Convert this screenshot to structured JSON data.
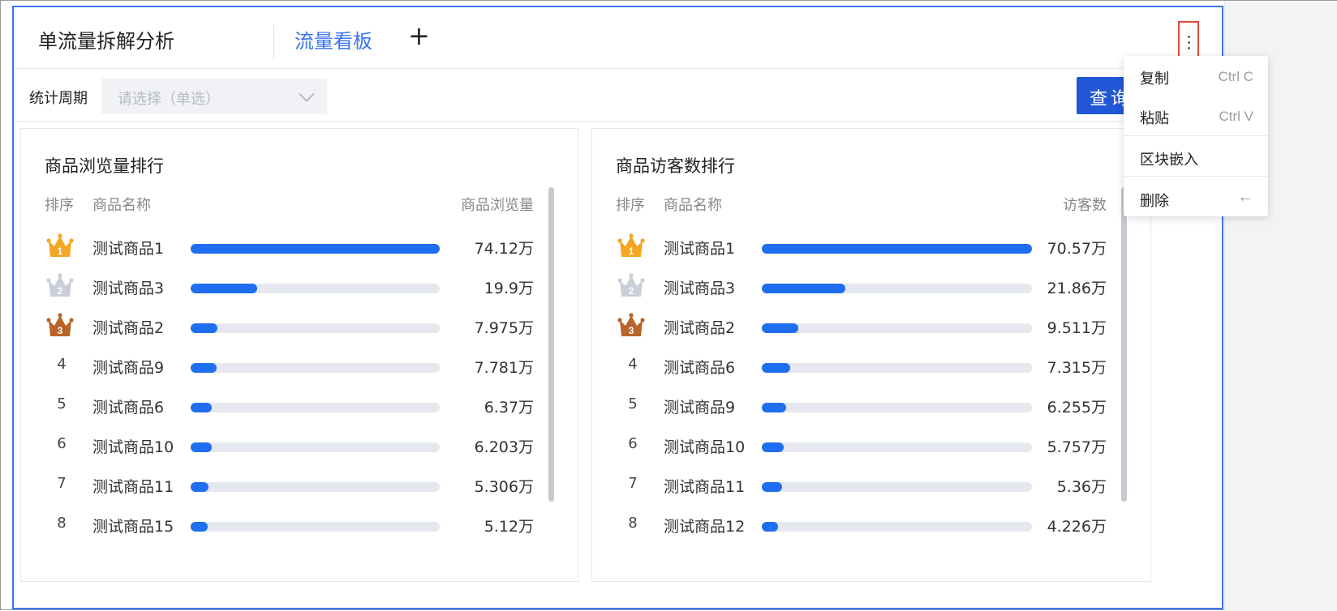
{
  "tabs": [
    {
      "label": "单流量拆解分析",
      "active": false
    },
    {
      "label": "流量看板",
      "active": true
    }
  ],
  "tab_add_label": "+",
  "filter": {
    "label": "统计周期",
    "placeholder": "请选择（单选）",
    "query_label": "查询"
  },
  "context_menu": {
    "copy": {
      "label": "复制",
      "shortcut": "Ctrl C"
    },
    "paste": {
      "label": "粘贴",
      "shortcut": "Ctrl V"
    },
    "embed": {
      "label": "区块嵌入"
    },
    "delete": {
      "label": "删除",
      "shortcut": "←"
    }
  },
  "panels": [
    {
      "title": "商品浏览量排行",
      "col_rank": "排序",
      "col_name": "商品名称",
      "col_value": "商品浏览量",
      "max": 74.12,
      "rows": [
        {
          "rank": "1",
          "name": "测试商品1",
          "value": 74.12,
          "value_text": "74.12万"
        },
        {
          "rank": "2",
          "name": "测试商品3",
          "value": 19.9,
          "value_text": "19.9万"
        },
        {
          "rank": "3",
          "name": "测试商品2",
          "value": 7.975,
          "value_text": "7.975万"
        },
        {
          "rank": "4",
          "name": "测试商品9",
          "value": 7.781,
          "value_text": "7.781万"
        },
        {
          "rank": "5",
          "name": "测试商品6",
          "value": 6.37,
          "value_text": "6.37万"
        },
        {
          "rank": "6",
          "name": "测试商品10",
          "value": 6.203,
          "value_text": "6.203万"
        },
        {
          "rank": "7",
          "name": "测试商品11",
          "value": 5.306,
          "value_text": "5.306万"
        },
        {
          "rank": "8",
          "name": "测试商品15",
          "value": 5.12,
          "value_text": "5.12万"
        }
      ]
    },
    {
      "title": "商品访客数排行",
      "col_rank": "排序",
      "col_name": "商品名称",
      "col_value": "访客数",
      "max": 70.57,
      "rows": [
        {
          "rank": "1",
          "name": "测试商品1",
          "value": 70.57,
          "value_text": "70.57万"
        },
        {
          "rank": "2",
          "name": "测试商品3",
          "value": 21.86,
          "value_text": "21.86万"
        },
        {
          "rank": "3",
          "name": "测试商品2",
          "value": 9.511,
          "value_text": "9.511万"
        },
        {
          "rank": "4",
          "name": "测试商品6",
          "value": 7.315,
          "value_text": "7.315万"
        },
        {
          "rank": "5",
          "name": "测试商品9",
          "value": 6.255,
          "value_text": "6.255万"
        },
        {
          "rank": "6",
          "name": "测试商品10",
          "value": 5.757,
          "value_text": "5.757万"
        },
        {
          "rank": "7",
          "name": "测试商品11",
          "value": 5.36,
          "value_text": "5.36万"
        },
        {
          "rank": "8",
          "name": "测试商品12",
          "value": 4.226,
          "value_text": "4.226万"
        }
      ]
    }
  ],
  "colors": {
    "accent": "#3b76f0",
    "bar": "#1f6ef0",
    "bar_track": "#e6e8ef",
    "gold": "#f5a623",
    "silver": "#c9ced8",
    "bronze": "#b9642a",
    "highlight_border": "#e14b3b"
  }
}
